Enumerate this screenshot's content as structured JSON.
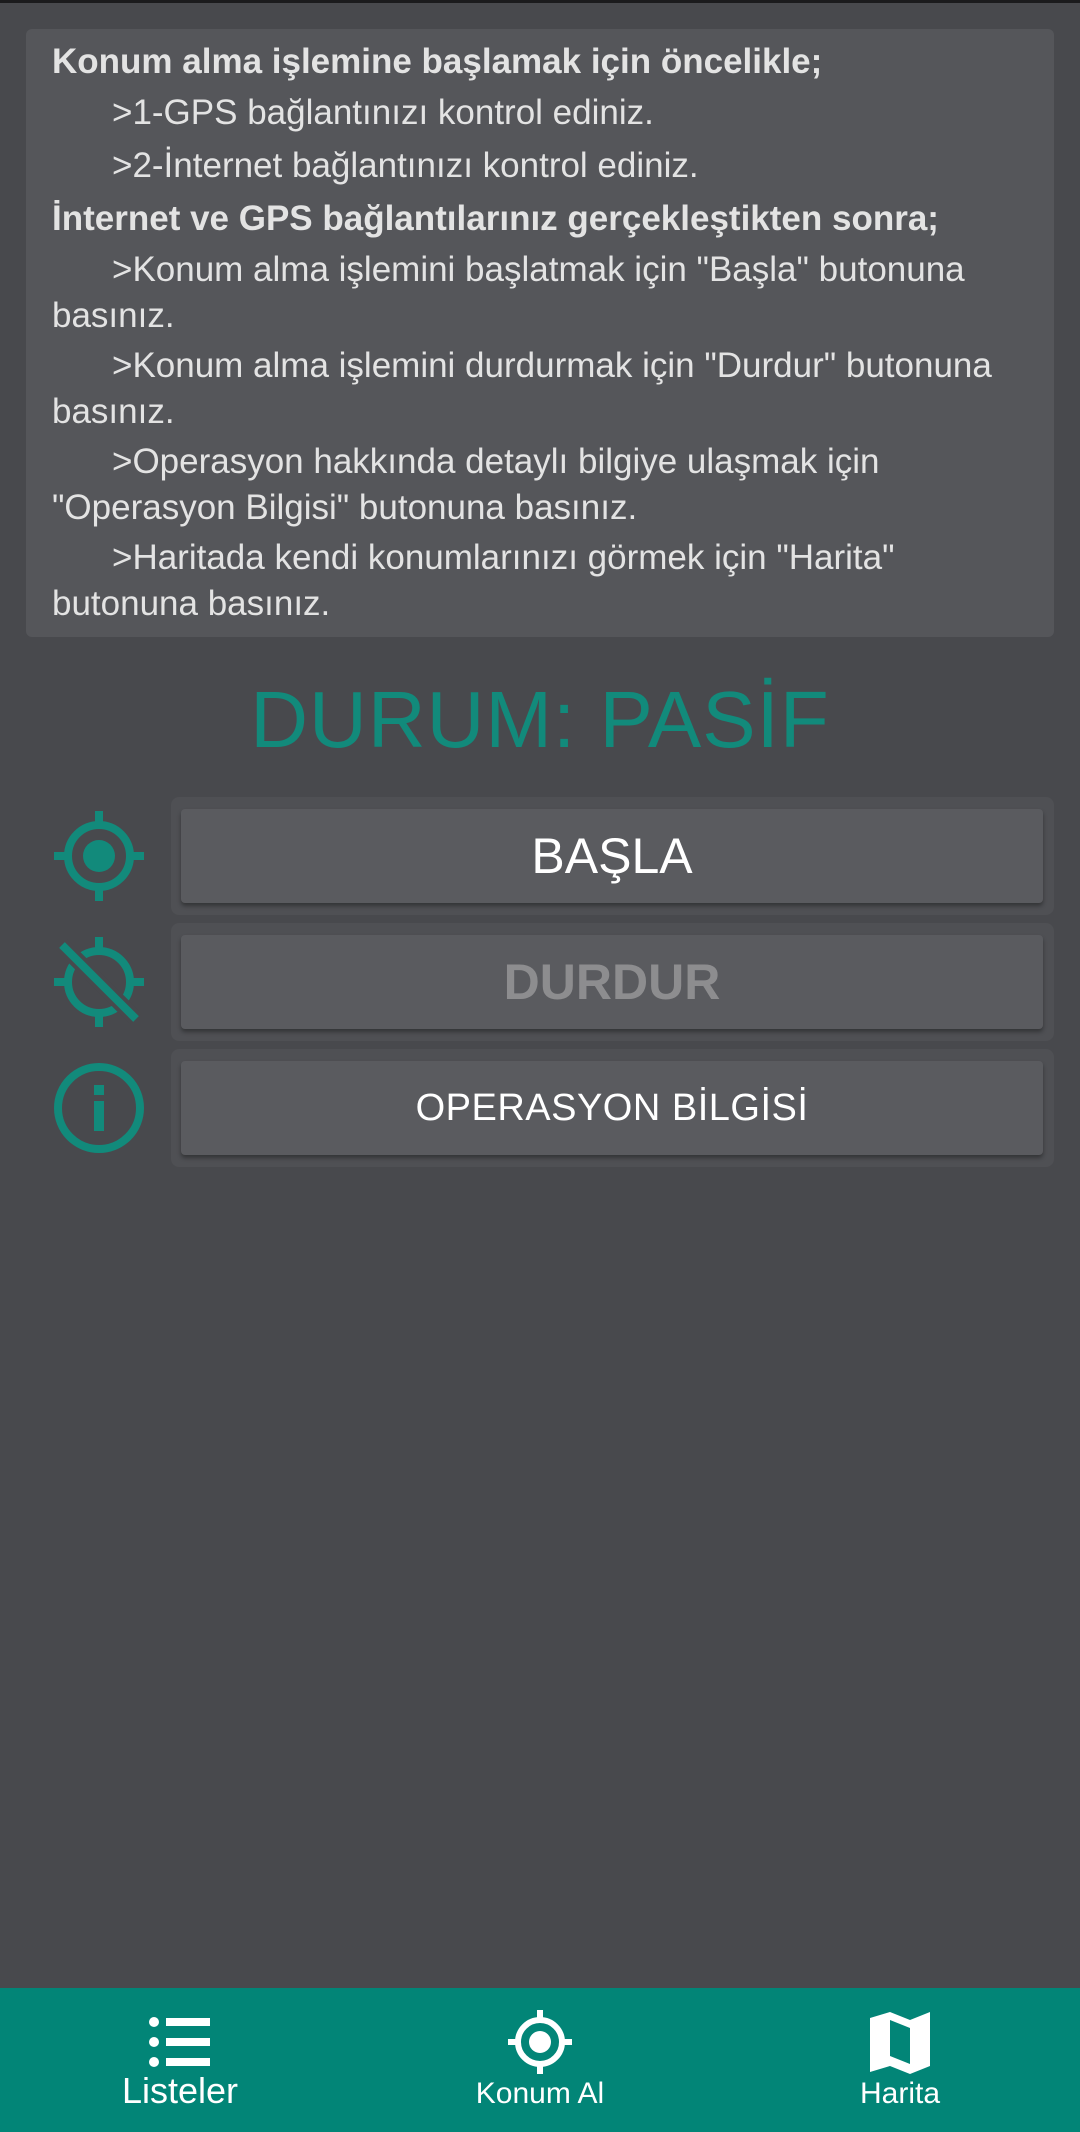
{
  "instructions": {
    "heading_1": "Konum alma işlemine başlamak için öncelikle;",
    "step_1": ">1-GPS bağlantınızı kontrol ediniz.",
    "step_2": ">2-İnternet bağlantınızı kontrol ediniz.",
    "heading_2": "İnternet ve GPS bağlantılarınız gerçekleştikten sonra;",
    "tip_start": ">Konum alma işlemini başlatmak için \"Başla\" butonuna basınız.",
    "tip_stop": ">Konum alma işlemini durdurmak için \"Durdur\" butonuna basınız.",
    "tip_info": ">Operasyon hakkında detaylı bilgiye ulaşmak için \"Operasyon Bilgisi\" butonuna basınız.",
    "tip_map": ">Haritada kendi konumlarınızı görmek için \"Harita\" butonuna basınız."
  },
  "status": {
    "text": "DURUM: PASİF"
  },
  "actions": {
    "start_label": "BAŞLA",
    "stop_label": "DURDUR",
    "info_label": "OPERASYON BİLGİSİ"
  },
  "bottom_nav": {
    "lists_label": "Listeler",
    "get_location_label": "Konum Al",
    "map_label": "Harita"
  },
  "colors": {
    "accent": "#128a7b",
    "nav_background": "#028577",
    "background": "#48494d"
  }
}
